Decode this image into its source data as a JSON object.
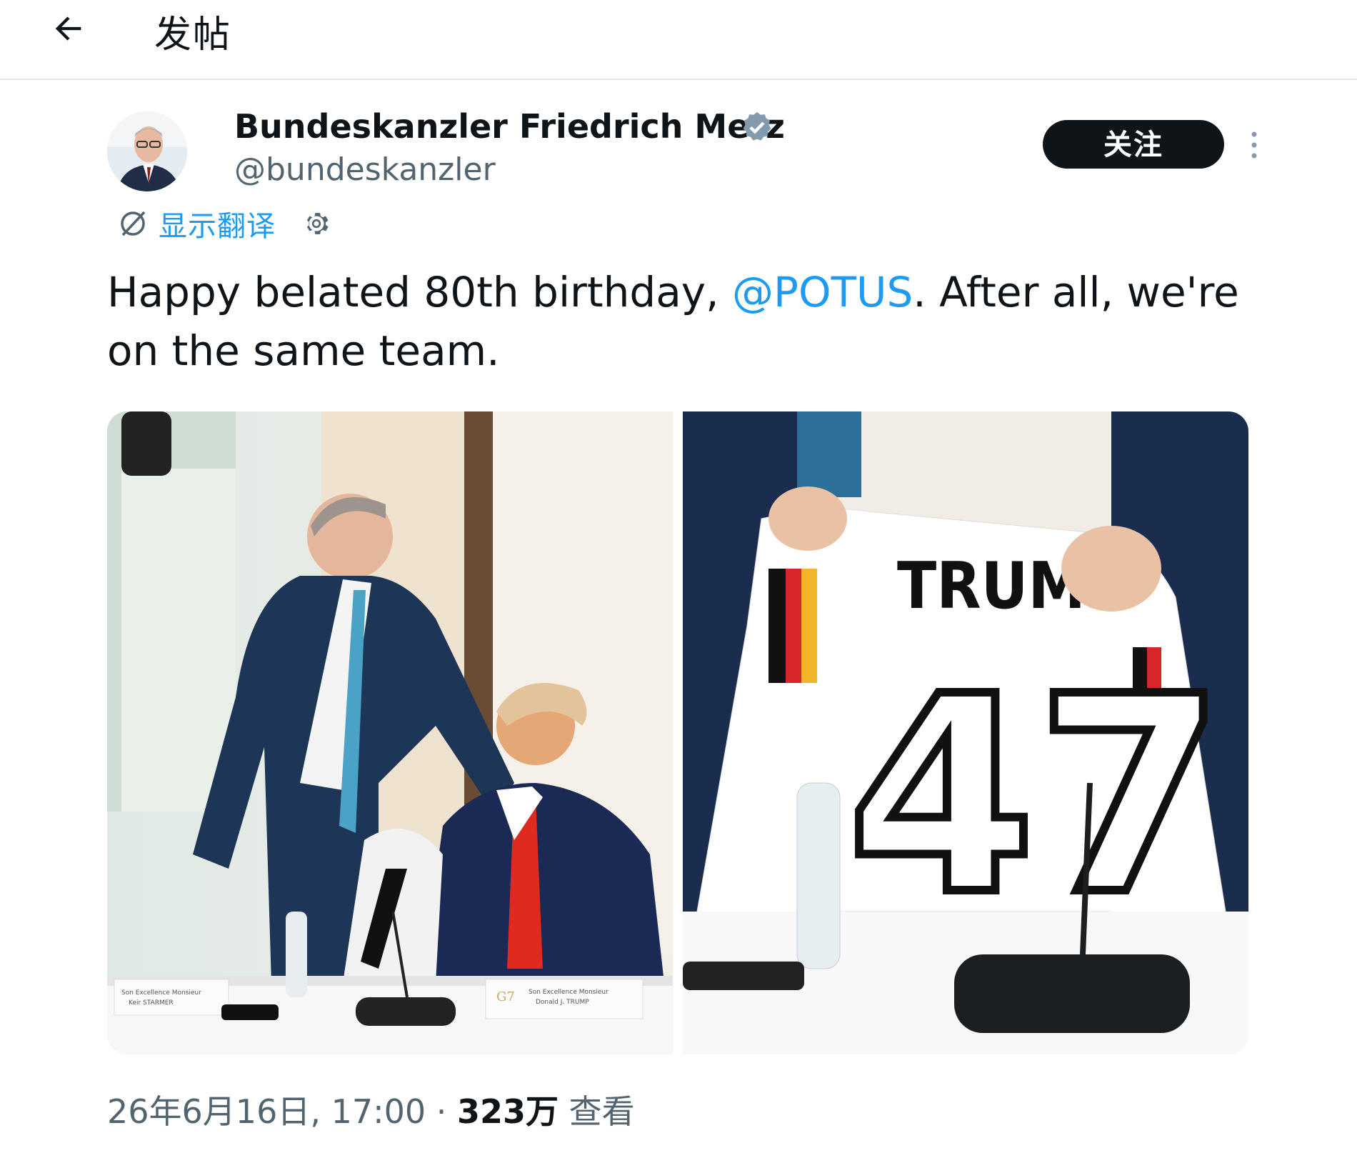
{
  "topbar": {
    "back_icon": "arrow-left-icon",
    "title": "发帖"
  },
  "author": {
    "display_name": "Bundeskanzler Friedrich Merz",
    "handle": "@bundeskanzler",
    "verified_icon": "verified-badge-icon",
    "verified_color": "#829aab",
    "follow_label": "关注",
    "more_icon": "more-vertical-icon"
  },
  "translate": {
    "icon": "translate-icon",
    "label": "显示翻译",
    "settings_icon": "gear-icon"
  },
  "tweet": {
    "text_before": "Happy belated 80th birthday, ",
    "mention": "@POTUS",
    "text_after": ". After all, we're on the same team."
  },
  "media": {
    "photos": [
      "photo-merz-trump",
      "photo-jersey"
    ],
    "jersey_name": "TRUMP",
    "jersey_number": "47",
    "nameplate_left_line1": "Son Excellence Monsieur",
    "nameplate_left_line2": "Keir STARMER",
    "nameplate_right_line1": "Son Excellence Monsieur",
    "nameplate_right_line2": "Donald J. TRUMP",
    "g7_logo": "G7"
  },
  "footer": {
    "datetime": "26年6月16日, 17:00",
    "separator": " · ",
    "views_count": "323万",
    "views_label": " 查看"
  },
  "colors": {
    "link": "#1d9bf0",
    "text": "#0f1419",
    "secondary": "#536471",
    "button_bg": "#0f1419"
  }
}
